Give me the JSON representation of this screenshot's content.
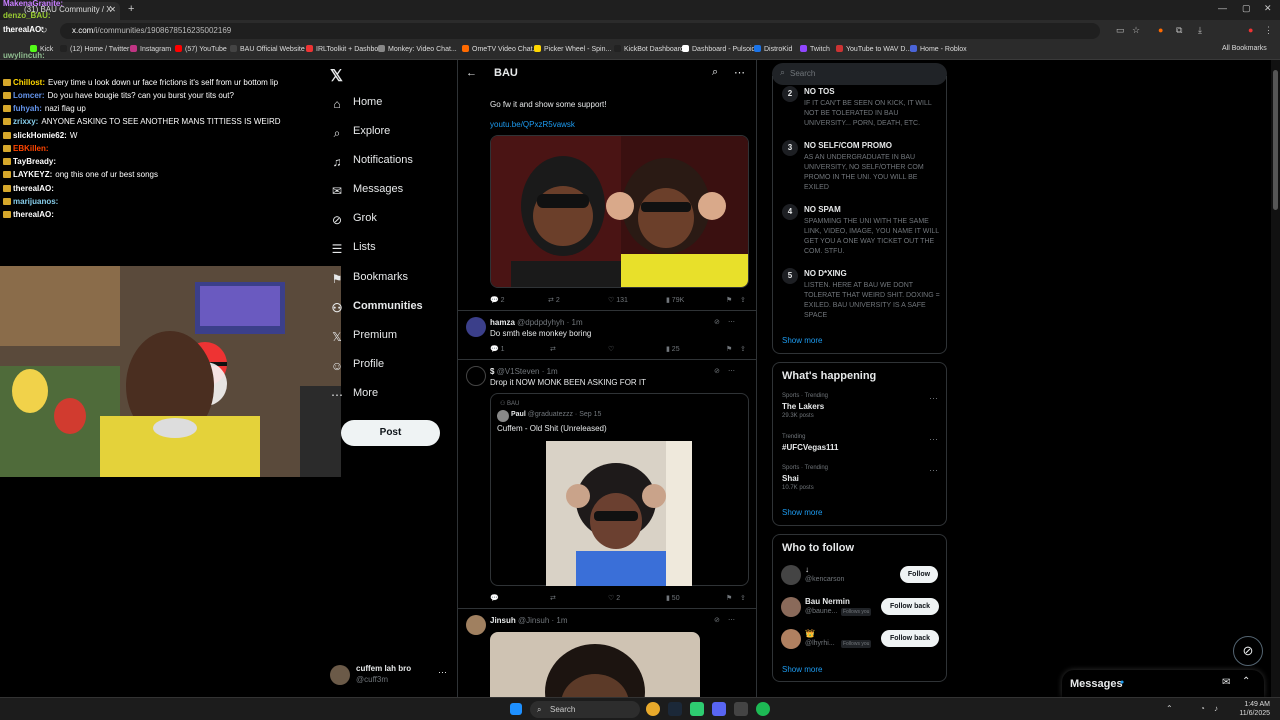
{
  "browser": {
    "tab_title": "(31) BAU Community / X",
    "url_host": "x.com",
    "url_path": "/i/communities/1908678516235002169",
    "bookmarks": [
      "Kick",
      "(12) Home / Twitter",
      "Instagram",
      "(57) YouTube",
      "BAU Official Website",
      "IRLToolkit + Dashbo...",
      "Monkey: Video Chat...",
      "OmeTV Video Chat...",
      "Picker Wheel - Spin...",
      "KickBot Dashboard",
      "Dashboard - Pulsoid",
      "DistroKid",
      "Twitch",
      "YouTube to WAV D...",
      "Home - Roblox"
    ],
    "all_bookmarks": "All Bookmarks"
  },
  "chat": [
    {
      "user": "MakenaGranite:",
      "msg": "",
      "color": "#c77dff"
    },
    {
      "user": "denzo_BAU:",
      "msg": "",
      "color": "#9acd32"
    },
    {
      "user": "therealAO:",
      "msg": "",
      "color": "#ffffff"
    },
    {
      "user": "uwylincuh:",
      "msg": "",
      "color": "#8fbc8f"
    },
    {
      "user": "Chillost:",
      "msg": "Every time u look down ur face frictions it's self from ur bottom lip",
      "color": "#ffd700"
    },
    {
      "user": "Lomcer:",
      "msg": "Do you have bougie tits? can you burst your tits out?",
      "color": "#6495ed"
    },
    {
      "user": "fuhyah:",
      "msg": "nazi flag up",
      "color": "#6495ed"
    },
    {
      "user": "zrixxy:",
      "msg": "ANYONE ASKING TO SEE ANOTHER MANS TITTIESS IS WEIRD",
      "color": "#87ceeb"
    },
    {
      "user": "slickHomie62:",
      "msg": "W",
      "color": "#ffffff"
    },
    {
      "user": "EBKillen:",
      "msg": "",
      "color": "#ff4500"
    },
    {
      "user": "TayBready:",
      "msg": "",
      "color": "#ffffff"
    },
    {
      "user": "LAYKEYZ:",
      "msg": "ong this one of ur best songs",
      "color": "#ffffff"
    },
    {
      "user": "therealAO:",
      "msg": "",
      "color": "#ffffff"
    },
    {
      "user": "marijuanos:",
      "msg": "",
      "color": "#87ceeb"
    },
    {
      "user": "therealAO:",
      "msg": "",
      "color": "#ffffff"
    }
  ],
  "nav": {
    "home": "Home",
    "explore": "Explore",
    "notifications": "Notifications",
    "messages": "Messages",
    "grok": "Grok",
    "lists": "Lists",
    "bookmarks": "Bookmarks",
    "communities": "Communities",
    "premium": "Premium",
    "profile": "Profile",
    "more": "More",
    "post": "Post",
    "account_name": "cuffem lah bro",
    "account_handle": "@cuff3m"
  },
  "feed": {
    "title": "BAU",
    "post1": {
      "text": "Go fw it and show some support!",
      "link": "youtu.be/QPxzR5vawsk",
      "replies": "2",
      "reposts": "2",
      "likes": "131",
      "views": "79K"
    },
    "post2": {
      "name": "hamza",
      "handle": "@dpdpdyhyh · 1m",
      "text": "Do smth else monkey boring",
      "replies": "1",
      "views": "25"
    },
    "post3": {
      "name": "$",
      "handle": "@V1Steven · 1m",
      "text": "Drop it NOW MONK BEEN ASKING FOR IT",
      "quote": {
        "community": "BAU",
        "name": "Paul",
        "handle": "@graduatezzz · Sep 15",
        "text": "Cuffem - Old Shit (Unreleased)"
      },
      "likes": "2",
      "views": "50"
    },
    "post4": {
      "name": "Jinsuh",
      "handle": "@Jinsuh · 1m"
    }
  },
  "sidebar": {
    "search_placeholder": "Search",
    "rules": [
      {
        "n": "2",
        "title": "NO TOS",
        "desc": "IF IT CAN'T BE SEEN ON KICK, IT WILL NOT BE TOLERATED IN BAU UNIVERSITY... PORN, DEATH, ETC."
      },
      {
        "n": "3",
        "title": "NO SELF/COM PROMO",
        "desc": "AS AN UNDERGRADUATE IN BAU UNIVERSITY, NO SELF/OTHER COM PROMO IN THE UNI. YOU WILL BE EXILED"
      },
      {
        "n": "4",
        "title": "NO SPAM",
        "desc": "SPAMMING THE UNI WITH THE SAME LINK, VIDEO, IMAGE, YOU NAME IT WILL GET YOU A ONE WAY TICKET OUT THE COM. STFU."
      },
      {
        "n": "5",
        "title": "NO D*XING",
        "desc": "LISTEN. HERE AT BAU WE DONT TOLERATE THAT WEIRD SHIT. DOXING = EXILED. BAU UNIVERSITY IS A SAFE SPACE"
      }
    ],
    "show_more": "Show more",
    "happening_title": "What's happening",
    "trends": [
      {
        "cat": "Sports · Trending",
        "name": "The Lakers",
        "posts": "29.3K posts"
      },
      {
        "cat": "Trending",
        "name": "#UFCVegas111",
        "posts": ""
      },
      {
        "cat": "Sports · Trending",
        "name": "Shai",
        "posts": "10.7K posts"
      }
    ],
    "follow_title": "Who to follow",
    "follows": [
      {
        "name": "↓",
        "handle": "@kencarson",
        "tag": "",
        "btn": "Follow"
      },
      {
        "name": "Bau Nermin",
        "handle": "@baune...",
        "tag": "Follows you",
        "btn": "Follow back"
      },
      {
        "name": "👑",
        "handle": "@lhyrhi...",
        "tag": "Follows you",
        "btn": "Follow back"
      }
    ],
    "messages": "Messages"
  },
  "taskbar": {
    "search": "Search",
    "time": "1:49 AM",
    "date": "11/6/2025"
  },
  "colors": {
    "accent": "#1d9bf0",
    "bg": "#000000",
    "border": "#2f3336",
    "muted": "#71767b"
  }
}
